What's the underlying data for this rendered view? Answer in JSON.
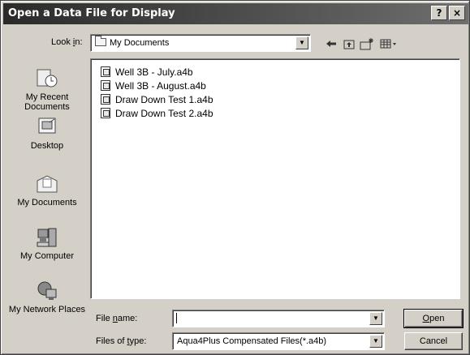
{
  "window": {
    "title": "Open a Data File for Display",
    "help_label": "?",
    "close_label": "×"
  },
  "lookin": {
    "label_prefix": "Look ",
    "label_hotkey": "i",
    "label_suffix": "n:",
    "value": "My Documents",
    "arrow": "▼"
  },
  "toolbar": {
    "back_icon": "back-arrow-icon",
    "up_icon": "up-folder-icon",
    "newfolder_icon": "new-folder-icon",
    "views_icon": "views-menu-icon"
  },
  "places": [
    {
      "label": "My Recent Documents",
      "icon": "recent-documents-icon"
    },
    {
      "label": "Desktop",
      "icon": "desktop-icon"
    },
    {
      "label": "My Documents",
      "icon": "my-documents-icon"
    },
    {
      "label": "My Computer",
      "icon": "my-computer-icon"
    },
    {
      "label": "My Network Places",
      "icon": "network-places-icon"
    }
  ],
  "files": [
    "Well 3B - July.a4b",
    "Well 3B - August.a4b",
    "Draw Down Test 1.a4b",
    "Draw Down Test 2.a4b"
  ],
  "filename": {
    "label_prefix": "File ",
    "label_hotkey": "n",
    "label_suffix": "ame:",
    "value": ""
  },
  "filetype": {
    "label_prefix": "Files of ",
    "label_hotkey": "t",
    "label_suffix": "ype:",
    "value": "Aqua4Plus Compensated Files(*.a4b)"
  },
  "buttons": {
    "open_hotkey": "O",
    "open_rest": "pen",
    "cancel": "Cancel"
  }
}
